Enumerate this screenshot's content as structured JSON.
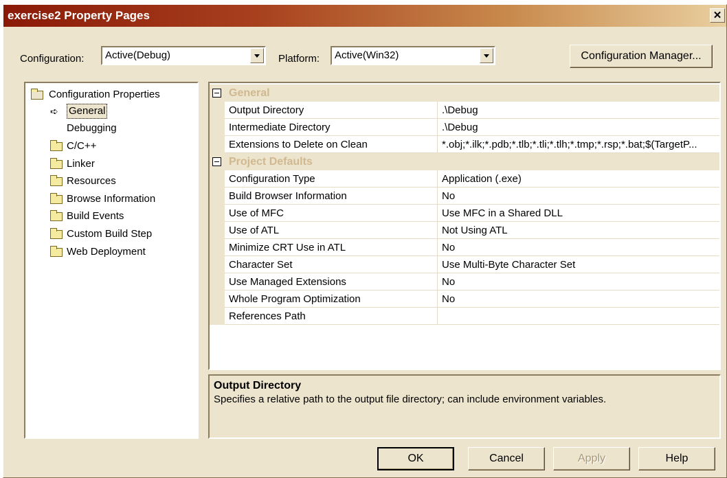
{
  "window": {
    "title": "exercise2 Property Pages",
    "close_glyph": "✕"
  },
  "toolbar": {
    "configuration_label": "Configuration:",
    "configuration_value": "Active(Debug)",
    "platform_label": "Platform:",
    "platform_value": "Active(Win32)",
    "config_manager_label": "Configuration Manager..."
  },
  "tree": {
    "root": "Configuration Properties",
    "items": [
      {
        "label": "General",
        "selected": true,
        "icon": "arrow-icon"
      },
      {
        "label": "Debugging",
        "icon": "none"
      },
      {
        "label": "C/C++",
        "icon": "folder-icon"
      },
      {
        "label": "Linker",
        "icon": "folder-icon"
      },
      {
        "label": "Resources",
        "icon": "folder-icon"
      },
      {
        "label": "Browse Information",
        "icon": "folder-icon"
      },
      {
        "label": "Build Events",
        "icon": "folder-icon"
      },
      {
        "label": "Custom Build Step",
        "icon": "folder-icon"
      },
      {
        "label": "Web Deployment",
        "icon": "folder-icon"
      }
    ]
  },
  "grid": {
    "general": {
      "title": "General",
      "rows": [
        {
          "name": "Output Directory",
          "value": ".\\Debug"
        },
        {
          "name": "Intermediate Directory",
          "value": ".\\Debug"
        },
        {
          "name": "Extensions to Delete on Clean",
          "value": "*.obj;*.ilk;*.pdb;*.tlb;*.tli;*.tlh;*.tmp;*.rsp;*.bat;$(TargetP..."
        }
      ]
    },
    "project_defaults": {
      "title": "Project Defaults",
      "rows": [
        {
          "name": "Configuration Type",
          "value": "Application (.exe)"
        },
        {
          "name": "Build Browser Information",
          "value": "No"
        },
        {
          "name": "Use of MFC",
          "value": "Use MFC in a Shared DLL"
        },
        {
          "name": "Use of ATL",
          "value": "Not Using ATL"
        },
        {
          "name": "Minimize CRT Use in ATL",
          "value": "No"
        },
        {
          "name": "Character Set",
          "value": "Use Multi-Byte Character Set"
        },
        {
          "name": "Use Managed Extensions",
          "value": "No"
        },
        {
          "name": "Whole Program Optimization",
          "value": "No"
        },
        {
          "name": "References Path",
          "value": ""
        }
      ]
    }
  },
  "description": {
    "title": "Output Directory",
    "text": "Specifies a relative path to the output file directory; can include environment variables."
  },
  "buttons": {
    "ok": "OK",
    "cancel": "Cancel",
    "apply": "Apply",
    "help": "Help"
  },
  "colors": {
    "dialog_bg": "#ece4cc",
    "title_start": "#8a1a08",
    "category_text": "#d0b890"
  }
}
